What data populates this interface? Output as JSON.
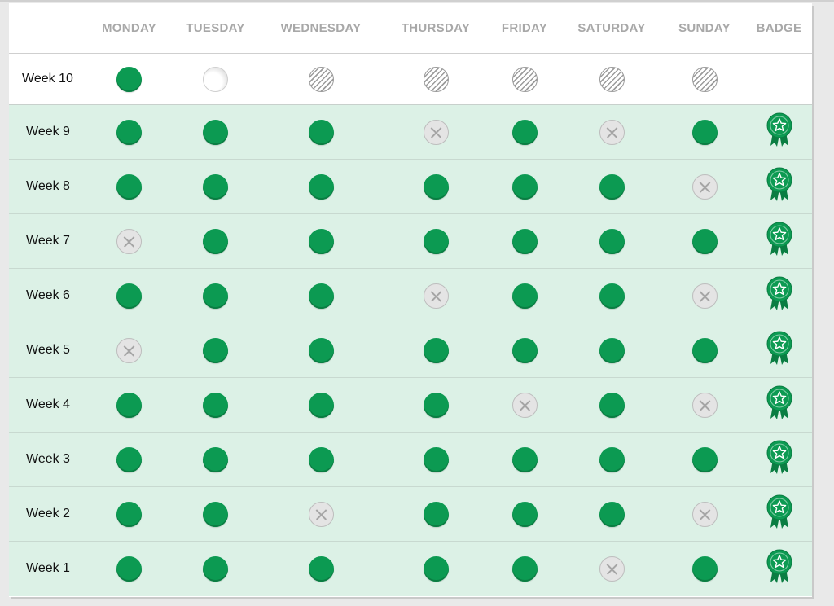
{
  "headers": [
    "MONDAY",
    "TUESDAY",
    "WEDNESDAY",
    "THURSDAY",
    "FRIDAY",
    "SATURDAY",
    "SUNDAY",
    "BADGE"
  ],
  "status_legend": {
    "done": "completed",
    "today": "today",
    "future": "upcoming",
    "missed": "missed"
  },
  "colors": {
    "accent": "#0c9a52",
    "row_bg": "#dcf1e6",
    "header_text": "#a8a8a8"
  },
  "weeks": [
    {
      "label": "Week 10",
      "days": [
        "done",
        "today",
        "future",
        "future",
        "future",
        "future",
        "future"
      ],
      "badge": false
    },
    {
      "label": "Week 9",
      "days": [
        "done",
        "done",
        "done",
        "missed",
        "done",
        "missed",
        "done"
      ],
      "badge": true
    },
    {
      "label": "Week 8",
      "days": [
        "done",
        "done",
        "done",
        "done",
        "done",
        "done",
        "missed"
      ],
      "badge": true
    },
    {
      "label": "Week 7",
      "days": [
        "missed",
        "done",
        "done",
        "done",
        "done",
        "done",
        "done"
      ],
      "badge": true
    },
    {
      "label": "Week 6",
      "days": [
        "done",
        "done",
        "done",
        "missed",
        "done",
        "done",
        "missed"
      ],
      "badge": true
    },
    {
      "label": "Week 5",
      "days": [
        "missed",
        "done",
        "done",
        "done",
        "done",
        "done",
        "done"
      ],
      "badge": true
    },
    {
      "label": "Week 4",
      "days": [
        "done",
        "done",
        "done",
        "done",
        "missed",
        "done",
        "missed"
      ],
      "badge": true
    },
    {
      "label": "Week 3",
      "days": [
        "done",
        "done",
        "done",
        "done",
        "done",
        "done",
        "done"
      ],
      "badge": true
    },
    {
      "label": "Week 2",
      "days": [
        "done",
        "done",
        "missed",
        "done",
        "done",
        "done",
        "missed"
      ],
      "badge": true
    },
    {
      "label": "Week 1",
      "days": [
        "done",
        "done",
        "done",
        "done",
        "done",
        "missed",
        "done"
      ],
      "badge": true
    }
  ],
  "badge_icon": "ribbon-star-badge-icon"
}
